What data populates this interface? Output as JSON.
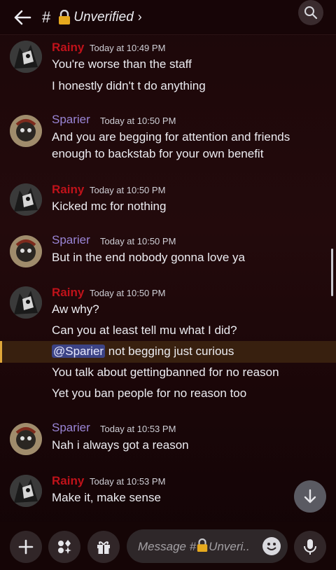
{
  "header": {
    "hash": "#",
    "channel": "Unverified",
    "chevron": "›",
    "lock_icon": "lock-icon"
  },
  "messages": [
    {
      "user": "Rainy",
      "time": "Today at 10:49 PM",
      "lines": [
        "You're worse than the staff",
        "I honestly didn't t do anything"
      ]
    },
    {
      "user": "Sparier",
      "time": "Today at 10:50 PM",
      "lines": [
        "And you are begging for attention and friends",
        "enough to backstab for your own benefit"
      ]
    },
    {
      "user": "Rainy",
      "time": "Today at 10:50 PM",
      "lines": [
        "Kicked mc for nothing"
      ]
    },
    {
      "user": "Sparier",
      "time": "Today at 10:50 PM",
      "lines": [
        "But in the end nobody gonna love ya"
      ]
    },
    {
      "user": "Rainy",
      "time": "Today at 10:50 PM",
      "lines": [
        "Aw why?",
        "Can you at least tell mu what I did?"
      ],
      "mention": "@Sparier",
      "mention_rest": " not begging just curious",
      "lines_after": [
        "You talk about gettingbanned for no reason",
        "Yet you ban people for no reason too"
      ]
    },
    {
      "user": "Sparier",
      "time": "Today at 10:53 PM",
      "lines": [
        "Nah i always got a reason"
      ]
    },
    {
      "user": "Rainy",
      "time": "Today at 10:53 PM",
      "lines": [
        "Make it, make sense"
      ]
    }
  ],
  "composer": {
    "placeholder": "Message #",
    "channel": "Unveri.."
  },
  "colors": {
    "rainy": "#c0121a",
    "sparier": "#9a85d6",
    "mention_bg": "#3c4385",
    "highlight_border": "#e0a73a"
  }
}
